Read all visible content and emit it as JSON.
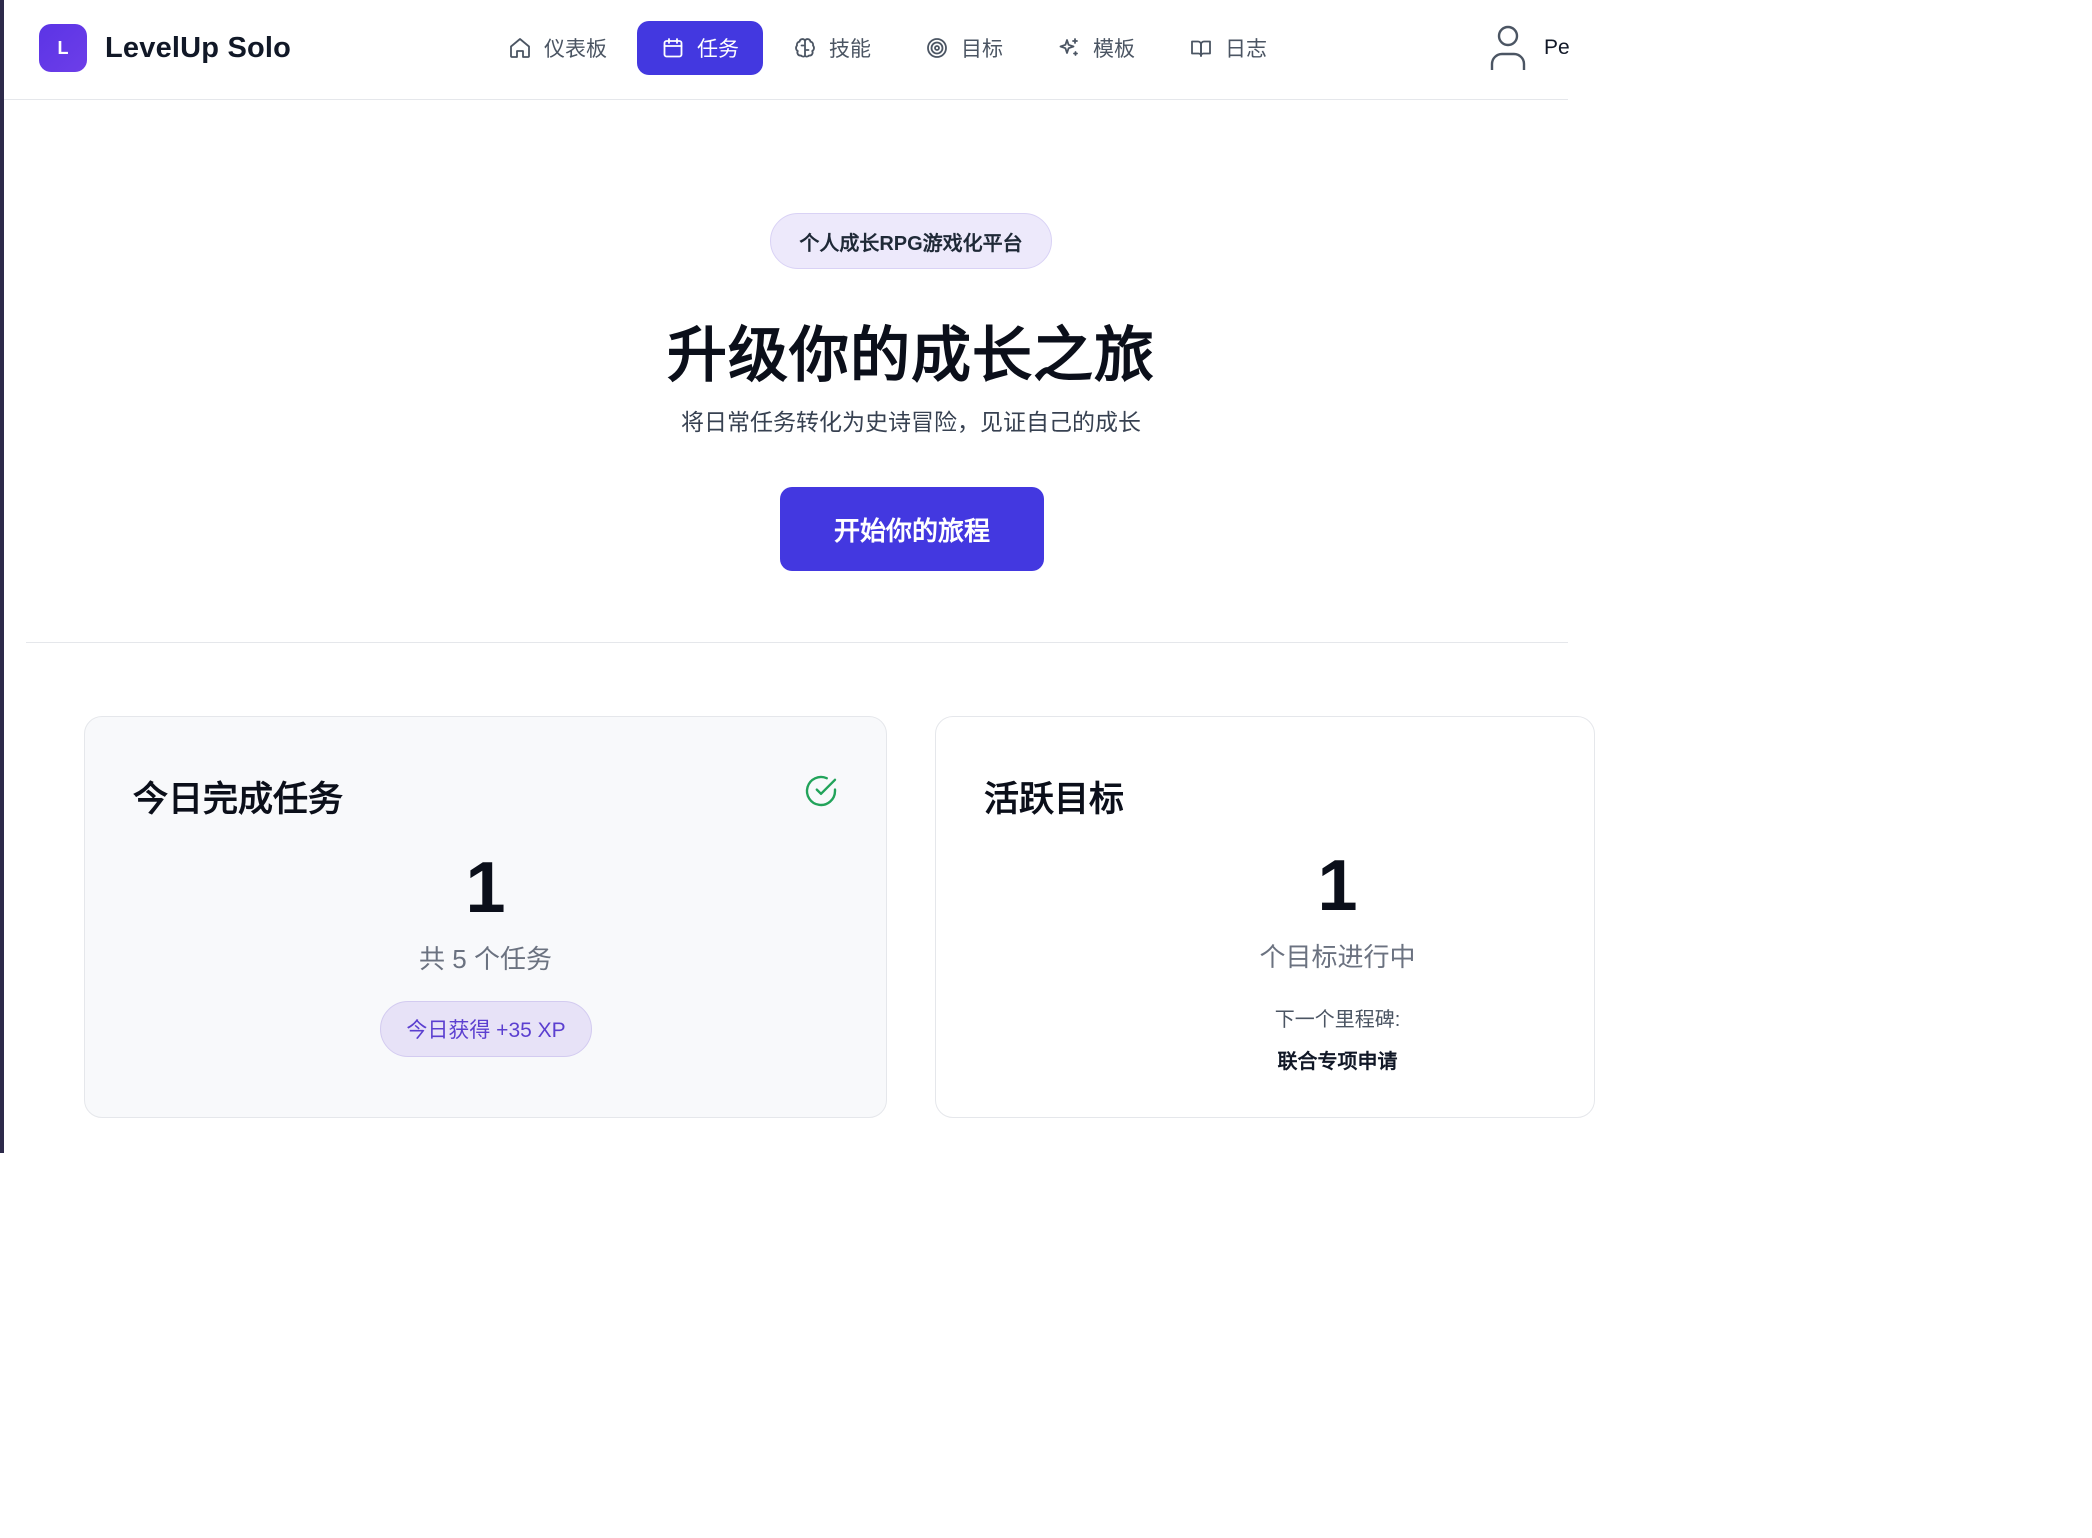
{
  "brand": {
    "logo_letter": "L",
    "name": "LevelUp Solo"
  },
  "nav": {
    "items": [
      {
        "label": "仪表板",
        "icon": "home-icon",
        "active": false
      },
      {
        "label": "任务",
        "icon": "calendar-icon",
        "active": true
      },
      {
        "label": "技能",
        "icon": "brain-icon",
        "active": false
      },
      {
        "label": "目标",
        "icon": "target-icon",
        "active": false
      },
      {
        "label": "模板",
        "icon": "sparkles-icon",
        "active": false
      },
      {
        "label": "日志",
        "icon": "book-open-icon",
        "active": false
      }
    ]
  },
  "user": {
    "name": "Pe",
    "icon": "user-icon"
  },
  "hero": {
    "pill": "个人成长RPG游戏化平台",
    "title": "升级你的成长之旅",
    "subtitle": "将日常任务转化为史诗冒险，见证自己的成长",
    "cta": "开始你的旅程"
  },
  "cards": {
    "tasks": {
      "title": "今日完成任务",
      "icon": "check-circle-icon",
      "count": "1",
      "total_text": "共 5 个任务",
      "xp_badge": "今日获得 +35 XP"
    },
    "goals": {
      "title": "活跃目标",
      "count": "1",
      "status_text": "个目标进行中",
      "milestone_label": "下一个里程碑:",
      "milestone_value": "联合专项申请"
    }
  },
  "colors": {
    "primary": "#4338e0",
    "logo": "#5b34e6",
    "check": "#22a35a",
    "xp_text": "#5b3fd0"
  }
}
